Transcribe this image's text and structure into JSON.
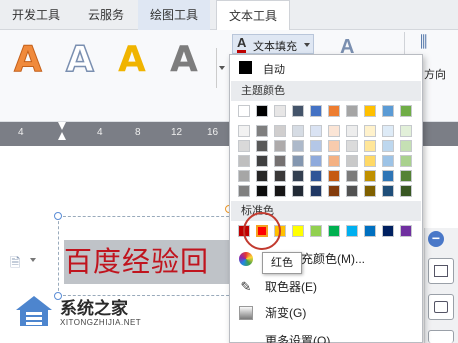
{
  "tabs": [
    {
      "label": "开发工具"
    },
    {
      "label": "云服务"
    },
    {
      "label": "绘图工具"
    },
    {
      "label": "文本工具"
    }
  ],
  "ribbon": {
    "wordart_glyph": "A",
    "text_fill_label": "文本填充",
    "direction_label": "方向",
    "wordart_colors": [
      "#f08a3c",
      "#7a8fb0",
      "#f0b400",
      "#7d7d7d"
    ]
  },
  "ruler": {
    "numbers": [
      "4",
      "4",
      "8",
      "12",
      "16"
    ]
  },
  "document": {
    "selected_text": "百度经验回"
  },
  "dropdown": {
    "auto_label": "自动",
    "theme_colors_title": "主题颜色",
    "standard_colors_title": "标准色",
    "theme_top_row": [
      "#ffffff",
      "#000000",
      "#e7e6e6",
      "#44546a",
      "#4472c4",
      "#ed7d31",
      "#a5a5a5",
      "#ffc000",
      "#5b9bd5",
      "#70ad47"
    ],
    "theme_shades": [
      [
        "#f2f2f2",
        "#7f7f7f",
        "#d0cece",
        "#d6dce4",
        "#dae3f3",
        "#fbe5d6",
        "#ededed",
        "#fff2cc",
        "#deebf7",
        "#e2f0d9"
      ],
      [
        "#d9d9d9",
        "#595959",
        "#aeabab",
        "#adb9ca",
        "#b4c7e7",
        "#f8cbad",
        "#dbdbdb",
        "#ffe699",
        "#bdd7ee",
        "#c5e0b4"
      ],
      [
        "#bfbfbf",
        "#404040",
        "#757171",
        "#8497b0",
        "#8faadc",
        "#f4b183",
        "#c9c9c9",
        "#ffd966",
        "#9dc3e6",
        "#a9d18e"
      ],
      [
        "#a6a6a6",
        "#262626",
        "#3a3838",
        "#333f50",
        "#2f5597",
        "#c55a11",
        "#7b7b7b",
        "#bf9000",
        "#2e75b6",
        "#548235"
      ],
      [
        "#808080",
        "#0d0d0d",
        "#171616",
        "#222a35",
        "#203864",
        "#843c0c",
        "#525252",
        "#7f6000",
        "#1f4e79",
        "#385723"
      ]
    ],
    "standard_colors": [
      "#c00000",
      "#ff0000",
      "#ffc000",
      "#ffff00",
      "#92d050",
      "#00b050",
      "#00b0f0",
      "#0070c0",
      "#002060",
      "#7030a0"
    ],
    "more_colors_label": "其他填充颜色(M)...",
    "eyedropper_label": "取色器(E)",
    "gradient_label": "渐变(G)",
    "more_settings_label": "更多设置(O)..."
  },
  "tooltip": {
    "text": "红色"
  },
  "watermark": {
    "title": "系统之家",
    "subtitle": "XITONGZHIJIA.NET"
  }
}
